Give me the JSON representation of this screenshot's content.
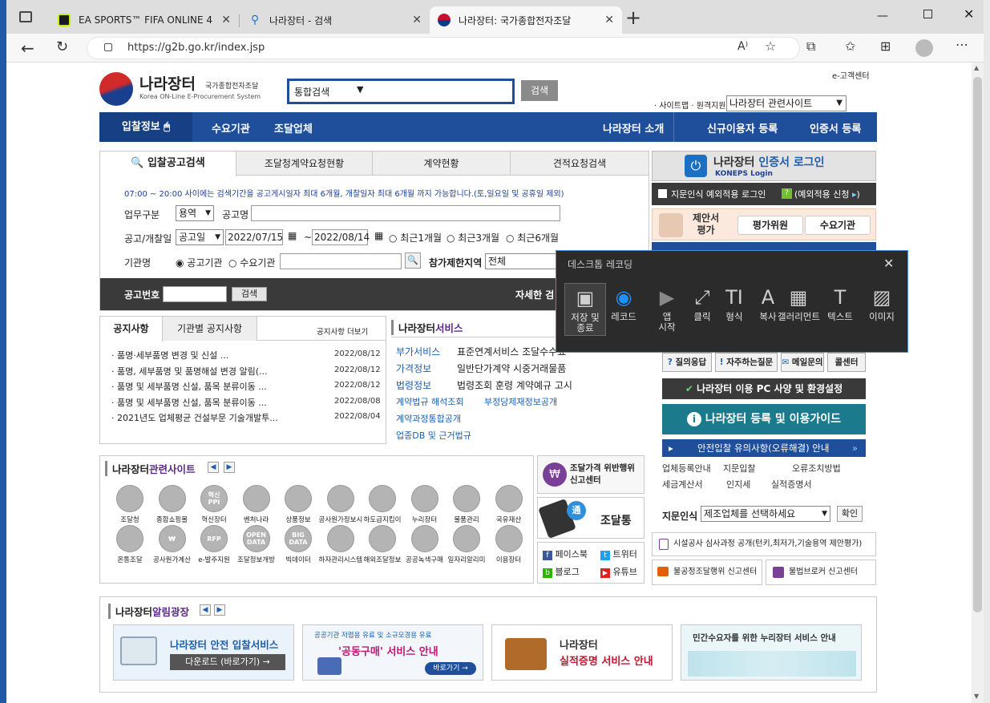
{
  "browser": {
    "tabs": [
      {
        "title": "EA SPORTS™ FIFA ONLINE 4",
        "icon": "fifa-icon",
        "active": false
      },
      {
        "title": "나라장터 - 검색",
        "icon": "search-icon",
        "active": false
      },
      {
        "title": "나라장터: 국가종합전자조달",
        "icon": "korea-emblem-icon",
        "active": true
      }
    ],
    "new_tab": "+",
    "url": "https://g2b.go.kr/index.jsp"
  },
  "header": {
    "logo_main": "나라장터",
    "logo_sub": "국가종합전자조달",
    "logo_en": "Korea ON-Line E-Procurement System",
    "search_select": "통합검색",
    "search_button": "검색",
    "top_link": "e-고객센터",
    "util_links": "· 사이트맵 · 원격지원",
    "related_select": "나라장터 관련사이트"
  },
  "nav": {
    "left": [
      "입찰정보",
      "수요기관",
      "조달업체"
    ],
    "right": [
      "나라장터 소개",
      "신규이용자 등록",
      "인증서 등록"
    ]
  },
  "search_panel": {
    "tabs": [
      "입찰공고검색",
      "조달청계약요청현황",
      "계약현황",
      "견적요청검색"
    ],
    "notice": "07:00 ~ 20:00 사이에는 검색기간을 공고게시일자 최대 6개월, 개찰일자 최대 6개월 까지 가능합니다.(토,일요일 및 공휴일 제외)",
    "biz_type_label": "업무구분",
    "biz_type_value": "용역",
    "notice_name_label": "공고명",
    "date_label": "공고/개찰일",
    "date_type": "공고일",
    "date_from": "2022/07/15",
    "date_to": "2022/08/14",
    "tilde": "~",
    "radio_periods": [
      "최근1개월",
      "최근3개월",
      "최근6개월"
    ],
    "org_label": "기관명",
    "org_radios": [
      "공고기관",
      "수요기관"
    ],
    "region_label": "참가제한지역",
    "region_value": "전체",
    "notice_no_label": "공고번호",
    "notice_no_button": "검색",
    "detail_search": "자세한 검"
  },
  "notices": {
    "tabs": [
      "공지사항",
      "기관별 공지사항"
    ],
    "more": "공지사항 더보기",
    "items": [
      {
        "title": "· 품명·세부품명 변경 및 신설 ...",
        "date": "2022/08/12"
      },
      {
        "title": "· 품명, 세부품명 및 품명해설 변경 알림(...",
        "date": "2022/08/12"
      },
      {
        "title": "· 품명 및 세부품명 신설, 품목 분류이동 ...",
        "date": "2022/08/12"
      },
      {
        "title": "· 품명 및 세부품명 신설, 품목 분류이동 ...",
        "date": "2022/08/08"
      },
      {
        "title": "· 2021년도 업체평균 건설부문 기술개발투...",
        "date": "2022/08/04"
      }
    ]
  },
  "services": {
    "title_a": "나라장터",
    "title_b": "서비스",
    "rows": [
      {
        "key": "부가서비스",
        "value": "표준연계서비스  조달수수료"
      },
      {
        "key": "가격정보",
        "value": "일반단가계약 시중거래물품"
      },
      {
        "key": "법령정보",
        "value": "법령조회  훈령  계약예규  고시"
      }
    ],
    "links": [
      "계약법규 해석조회",
      "부정당제재정보공개",
      "계약과정통합공개",
      "업종DB 및 근거법규"
    ]
  },
  "related_sites": {
    "title_a": "나라장터",
    "title_b": "관련사이트",
    "row1": [
      "조달청",
      "종합쇼핑몰",
      "혁신장터",
      "벤처나라",
      "상품정보",
      "공사원가정보시스템",
      "하도급지킴이",
      "누리장터",
      "물품관리",
      "국유재산"
    ],
    "row2": [
      "온통조달",
      "공사원가계산",
      "e-발주지원",
      "조달정보개방",
      "빅데이터",
      "하자관리시스템",
      "해외조달정보",
      "공공녹색구매",
      "일자리알리미",
      "이용장터"
    ],
    "icon_texts": {
      "innov": "혁신\nPPI",
      "rfp": "RFP",
      "open": "OPEN\nDATA",
      "big": "BIG\nDATA",
      "won": "₩"
    }
  },
  "mid_right": {
    "report_center": "조달가격 위반행위 신고센터",
    "app": "조달통",
    "social": [
      "페이스북",
      "트위터",
      "블로그",
      "유튜브"
    ]
  },
  "right_col": {
    "login_title_a": "나라장터 ",
    "login_title_b": "인증서 로그인",
    "login_sub": "KONEPS Login",
    "fingerprint_check": "지문인식 예외적용 로그인",
    "fingerprint_apply": "(예외적용 신청",
    "proposal_label": "제안서\n평가",
    "proposal_buttons": [
      "평가위원",
      "수요기관"
    ],
    "help_buttons": [
      "질의응답",
      "자주하는질문",
      "메일문의",
      "콜센터"
    ],
    "pc_env": "나라장터 이용 PC 사양 및 환경설정",
    "guide": "나라장터 등록 및 이용가이드",
    "safe_bid": "안전입찰 유의사항(오류해결) 안내",
    "links": [
      "업체등록안내",
      "지문입찰",
      "오류조치방법",
      "세금계산서",
      "인지세",
      "실적증명서"
    ],
    "fp_label": "지문인식",
    "fp_select": "제조업체를 선택하세요",
    "fp_button": "확인",
    "review_notice": "시설공사 심사과정 공개(턴키,최저가,기술용역 제안평가)",
    "unfair_center": "불공정조달행위 신고센터",
    "broker_center": "불법브로커 신고센터"
  },
  "plaza": {
    "title_a": "나라장터",
    "title_b": "알림광장",
    "banners": [
      {
        "title": "나라장터 안전 입찰서비스",
        "sub": "다운로드 (바로가기)"
      },
      {
        "title": "공공기관 저렴용 유료 및 소규모경용 유료",
        "title2": "'공동구매' 서비스 안내",
        "sub": "바로가기"
      },
      {
        "title": "나라장터",
        "title2": "실적증명 서비스 안내"
      },
      {
        "title": "민간수요자를 위한 누리장터 서비스 안내"
      }
    ]
  },
  "recorder": {
    "title": "데스크톱 레코딩",
    "tools": [
      "저장 및\n종료",
      "레코드",
      "앱\n시작",
      "클릭",
      "형식",
      "복사",
      "갤러리먼트",
      "텍스트",
      "이미지"
    ]
  },
  "colors": {
    "nav_blue": "#1f4e9b",
    "title_purple": "#5b2a86",
    "link_blue": "#1d5fae",
    "teal": "#1b7b8c"
  }
}
